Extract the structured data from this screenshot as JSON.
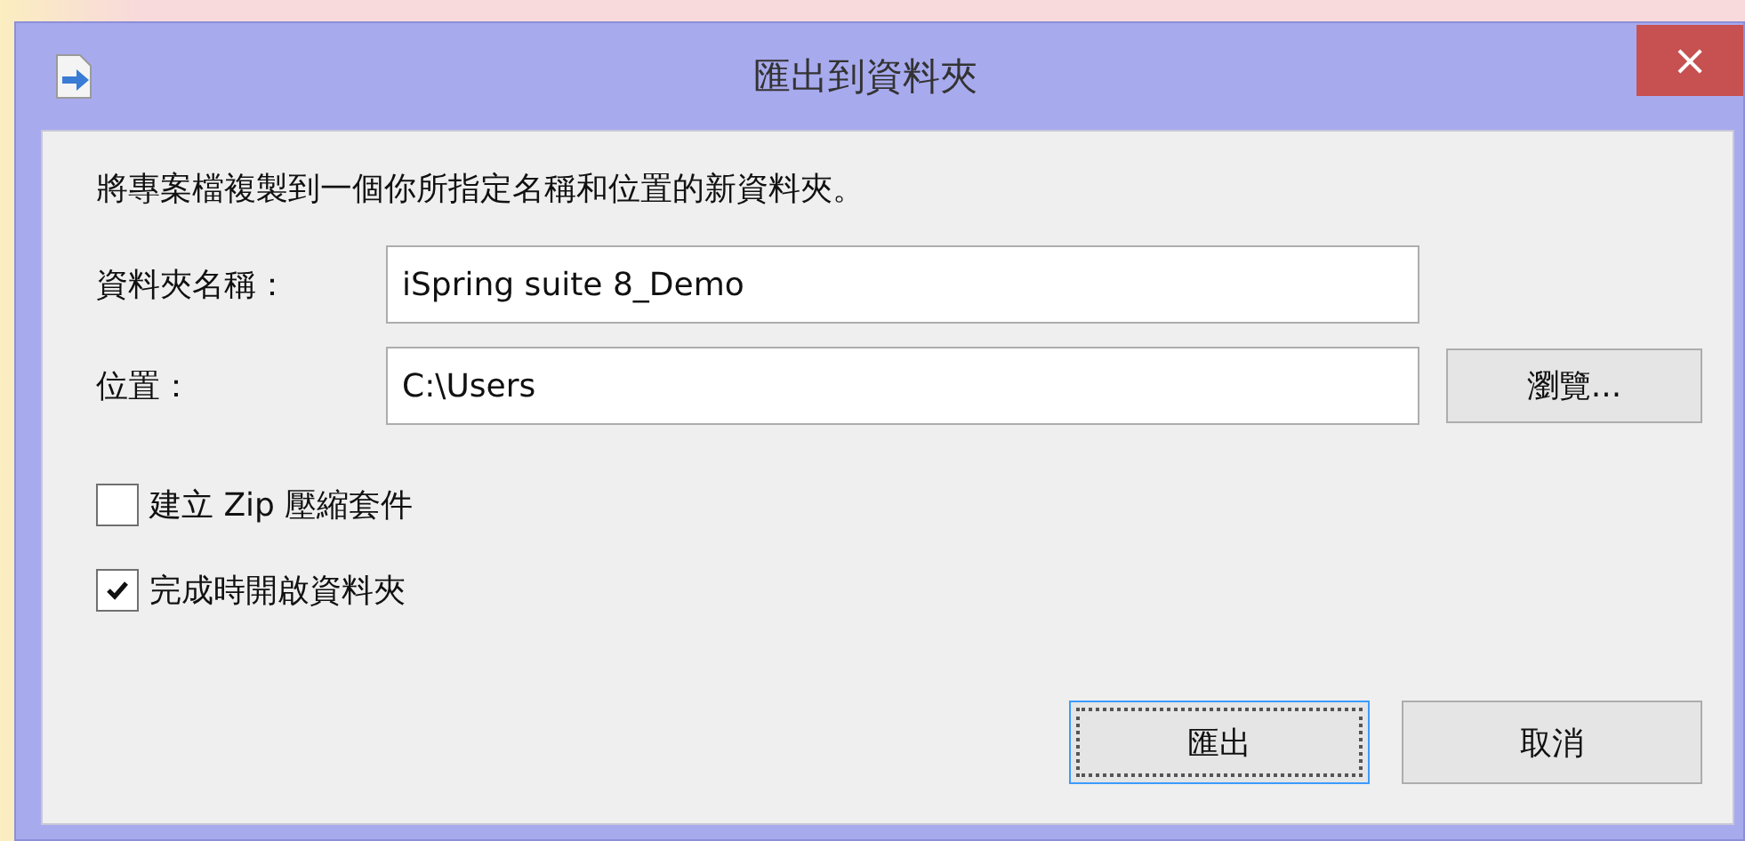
{
  "window": {
    "title": "匯出到資料夾",
    "close": "×"
  },
  "description": "將專案檔複製到一個你所指定名稱和位置的新資料夾。",
  "fields": [
    {
      "label": "資料夾名稱：",
      "value": "iSpring suite 8_Demo"
    },
    {
      "label": "位置：",
      "value": "C:\\Users",
      "button": "瀏覽..."
    }
  ],
  "checkboxes": [
    {
      "label": "建立 Zip 壓縮套件",
      "checked": false
    },
    {
      "label": "完成時開啟資料夾",
      "checked": true
    }
  ],
  "buttons": [
    {
      "label": "匯出",
      "selected": true
    },
    {
      "label": "取消",
      "selected": false
    }
  ]
}
